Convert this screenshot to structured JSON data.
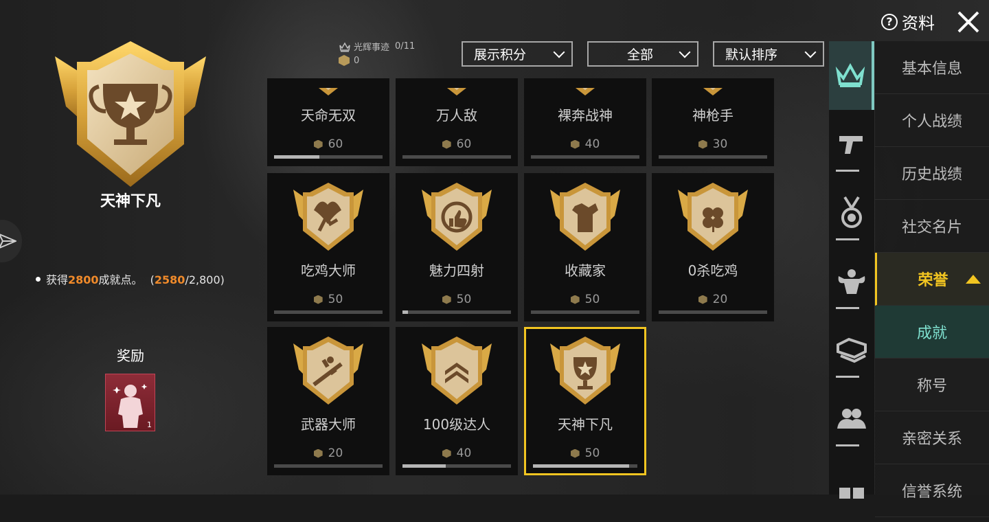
{
  "header": {
    "info_label": "资料",
    "help_icon": "?"
  },
  "selected_achievement": {
    "title": "天神下凡",
    "requirement_prefix": "获得",
    "requirement_points": "2800",
    "requirement_suffix": "成就点。",
    "progress_open": "(",
    "progress_current": "2580",
    "progress_rest": "/2,800)",
    "reward_label": "奖励",
    "reward_count": "1"
  },
  "stats": {
    "glory_label": "光辉事迹",
    "glory_value": "0/11",
    "points_value": "0"
  },
  "filters": {
    "display": "展示积分",
    "category": "全部",
    "sort": "默认排序"
  },
  "cards": [
    {
      "name": "天命无双",
      "points": "60",
      "progress": 0.42
    },
    {
      "name": "万人敌",
      "points": "60",
      "progress": 0.0
    },
    {
      "name": "裸奔战神",
      "points": "40",
      "progress": 0.0
    },
    {
      "name": "神枪手",
      "points": "30",
      "progress": 0.0
    },
    {
      "name": "吃鸡大师",
      "points": "50",
      "progress": 0.0
    },
    {
      "name": "魅力四射",
      "points": "50",
      "progress": 0.05
    },
    {
      "name": "收藏家",
      "points": "50",
      "progress": 0.0
    },
    {
      "name": "0杀吃鸡",
      "points": "20",
      "progress": 0.0
    },
    {
      "name": "武器大师",
      "points": "20",
      "progress": 0.0
    },
    {
      "name": "100级达人",
      "points": "40",
      "progress": 0.4
    },
    {
      "name": "天神下凡",
      "points": "50",
      "progress": 0.92
    }
  ],
  "menu": {
    "items": [
      "基本信息",
      "个人战绩",
      "历史战绩",
      "社交名片",
      "荣誉",
      "成就",
      "称号",
      "亲密关系",
      "信誉系统"
    ]
  },
  "colors": {
    "accent_gold": "#f2c521",
    "accent_teal": "#7fe0cf",
    "orange": "#f08a2a"
  }
}
